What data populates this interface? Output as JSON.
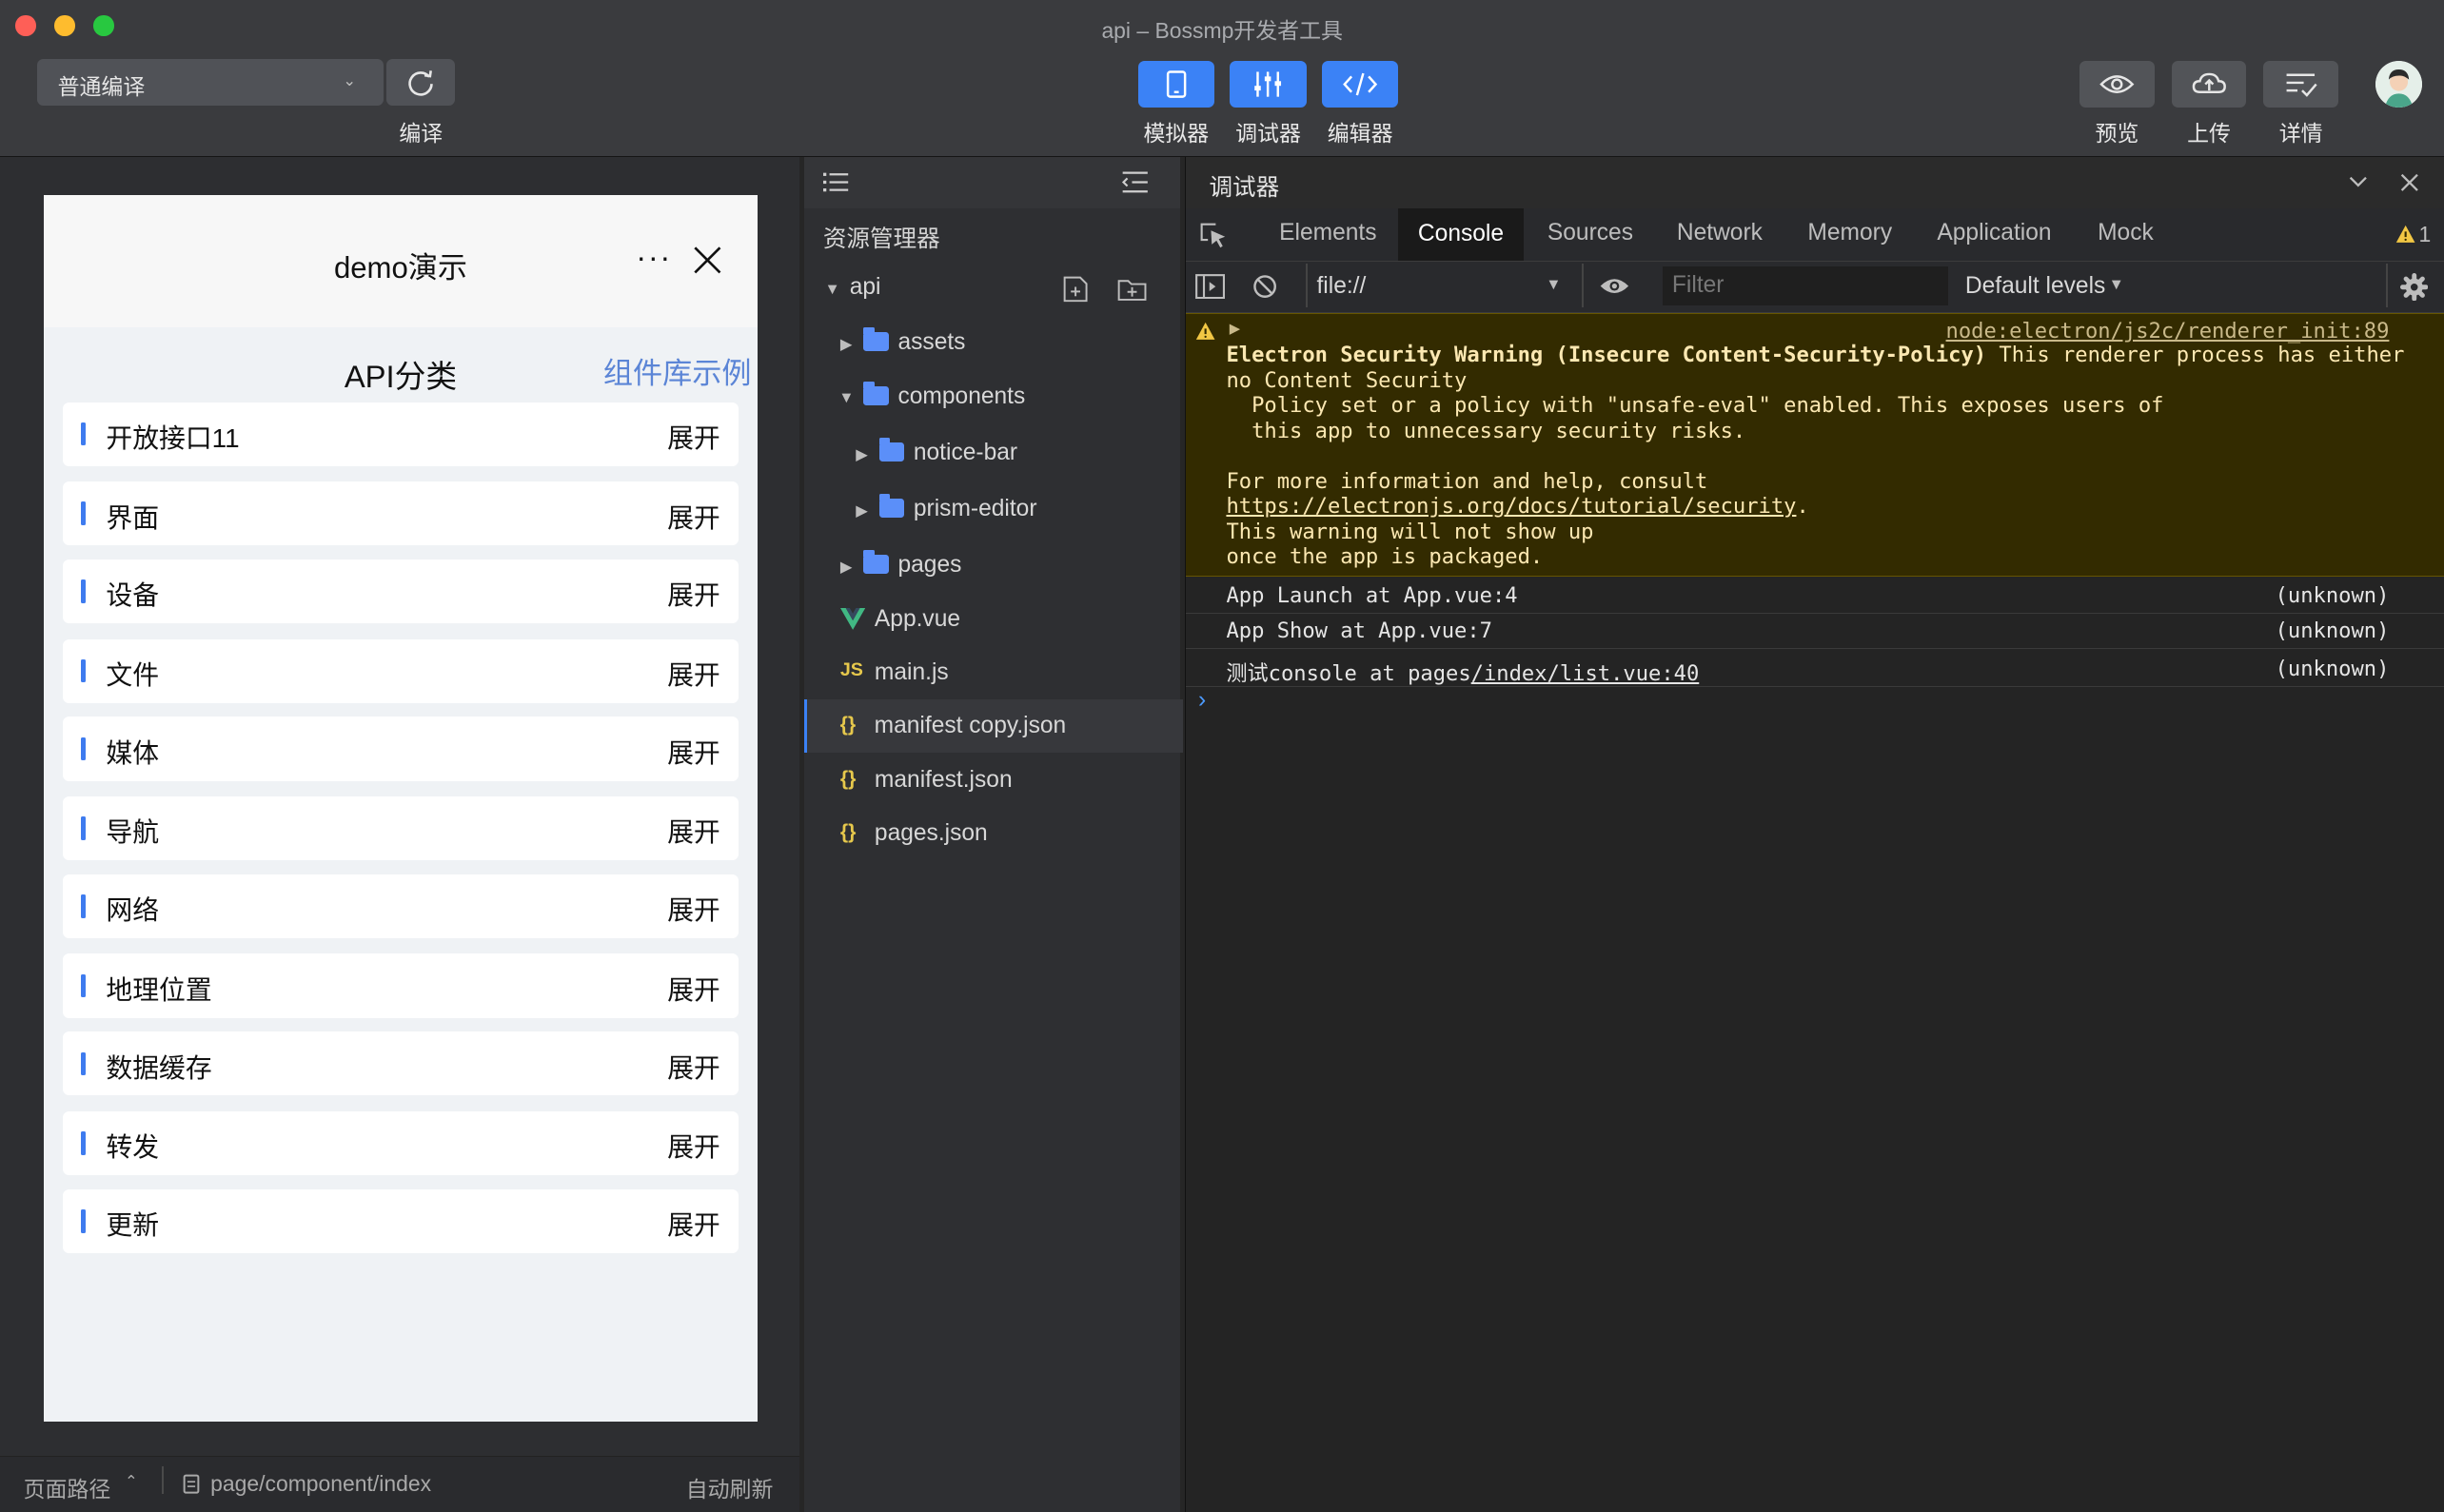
{
  "window": {
    "title": "api – Bossmp开发者工具"
  },
  "toolbar": {
    "mode_select": "普通编译",
    "compile_label": "编译",
    "simulator_label": "模拟器",
    "debugger_label": "调试器",
    "editor_label": "编辑器",
    "preview_label": "预览",
    "upload_label": "上传",
    "details_label": "详情"
  },
  "simulator": {
    "nav_title": "demo演示",
    "nav_more": "···",
    "api_title": "API分类",
    "lib_link": "组件库示例",
    "items": [
      {
        "name": "开放接口11",
        "action": "展开"
      },
      {
        "name": "界面",
        "action": "展开"
      },
      {
        "name": "设备",
        "action": "展开"
      },
      {
        "name": "文件",
        "action": "展开"
      },
      {
        "name": "媒体",
        "action": "展开"
      },
      {
        "name": "导航",
        "action": "展开"
      },
      {
        "name": "网络",
        "action": "展开"
      },
      {
        "name": "地理位置",
        "action": "展开"
      },
      {
        "name": "数据缓存",
        "action": "展开"
      },
      {
        "name": "转发",
        "action": "展开"
      },
      {
        "name": "更新",
        "action": "展开"
      }
    ],
    "status": {
      "path_label": "页面路径",
      "path": "page/component/index",
      "auto_refresh": "自动刷新"
    }
  },
  "explorer": {
    "title": "资源管理器",
    "root": "api",
    "tree": [
      {
        "label": "assets",
        "type": "folder"
      },
      {
        "label": "components",
        "type": "folder"
      },
      {
        "label": "notice-bar",
        "type": "folder"
      },
      {
        "label": "prism-editor",
        "type": "folder"
      },
      {
        "label": "pages",
        "type": "folder"
      },
      {
        "label": "App.vue",
        "type": "vue"
      },
      {
        "label": "main.js",
        "type": "js",
        "badge": "JS"
      },
      {
        "label": "manifest copy.json",
        "type": "json",
        "badge": "{}"
      },
      {
        "label": "manifest.json",
        "type": "json",
        "badge": "{}"
      },
      {
        "label": "pages.json",
        "type": "json",
        "badge": "{}"
      }
    ]
  },
  "debugger": {
    "title": "调试器",
    "tabs": [
      "Elements",
      "Console",
      "Sources",
      "Network",
      "Memory",
      "Application",
      "Mock"
    ],
    "active_tab": "Console",
    "warning_count": "1",
    "context": "file://",
    "filter_placeholder": "Filter",
    "levels": "Default levels",
    "warning": {
      "source": "node:electron/js2c/renderer_init:89",
      "heading": "Electron Security Warning (Insecure Content-Security-Policy)",
      "line1_rest": " This renderer process has either",
      "line2": "no Content Security",
      "line3": "  Policy set or a policy with \"unsafe-eval\" enabled. This exposes users of",
      "line4": "  this app to unnecessary security risks.",
      "line5": "For more information and help, consult",
      "link": "https://electronjs.org/docs/tutorial/security",
      "link_tail": ".",
      "line7": "This warning will not show up",
      "line8": "once the app is packaged."
    },
    "logs": [
      {
        "message": "App Launch at App.vue:4",
        "source": "(unknown)"
      },
      {
        "message": "App Show at App.vue:7",
        "source": "(unknown)"
      }
    ],
    "log3": {
      "prefix": "测试console at pages",
      "link": "/index/list.vue:40",
      "source": "(unknown)"
    },
    "prompt": "›"
  },
  "colors": {
    "accent": "#3b82f6",
    "warning_bg": "#332b00",
    "warning_text": "#fce8b2",
    "link": "#5b85d6"
  }
}
